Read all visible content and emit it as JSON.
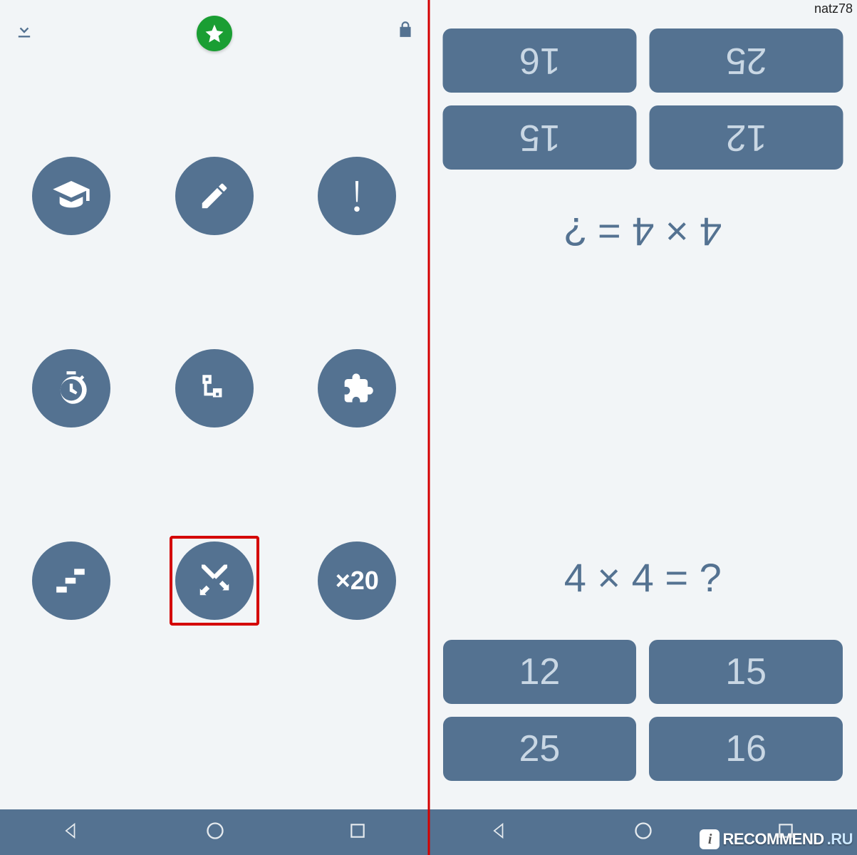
{
  "watermark": {
    "user": "natz78",
    "site_main": "RECOMMEND",
    "site_suffix": ".RU",
    "badge": "i"
  },
  "menu": {
    "icons": [
      "graduation-cap-icon",
      "pencil-icon",
      "exclamation-icon",
      "stopwatch-icon",
      "flowchart-icon",
      "puzzle-icon",
      "stairs-icon",
      "crossed-swords-icon",
      "x20-mode"
    ],
    "x20_label": "×20",
    "selected_index": 7
  },
  "game": {
    "question": "4 × 4 = ?",
    "player_top": {
      "answers": [
        "12",
        "15",
        "25",
        "16"
      ]
    },
    "player_bottom": {
      "answers": [
        "12",
        "15",
        "25",
        "16"
      ]
    }
  },
  "navbar": {
    "buttons": [
      "back",
      "home",
      "recent"
    ]
  }
}
